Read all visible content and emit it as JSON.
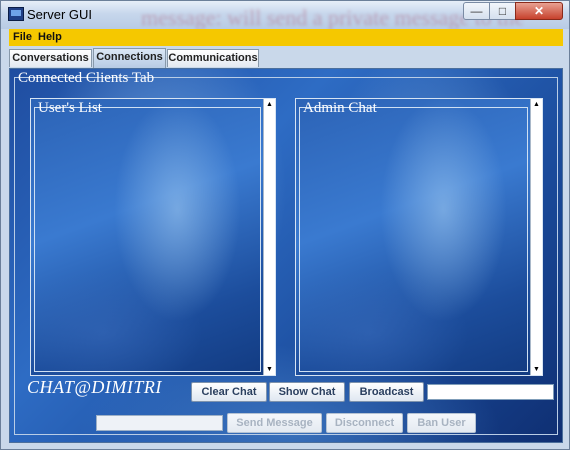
{
  "window": {
    "title": "Server GUI",
    "background_overlay_text": "message: will send a private message to the"
  },
  "menu": {
    "items": [
      {
        "label": "File"
      },
      {
        "label": "Help"
      }
    ]
  },
  "tabs": [
    {
      "label": "Conversations",
      "active": false
    },
    {
      "label": "Connections",
      "active": true
    },
    {
      "label": "Communications",
      "active": false
    }
  ],
  "panel": {
    "title": "Connected Clients Tab",
    "users_list": {
      "title": "User's List"
    },
    "admin_chat": {
      "title": "Admin Chat"
    },
    "brand": "CHAT@DIMITRI"
  },
  "buttons": {
    "clear_chat": "Clear Chat",
    "show_chat": "Show Chat",
    "broadcast": "Broadcast",
    "send_message": "Send Message",
    "disconnect": "Disconnect",
    "ban_user": "Ban User"
  },
  "inputs": {
    "broadcast_value": "",
    "message_value": ""
  },
  "colors": {
    "menubar": "#f5c800",
    "panel_blue": "#2e6cc4",
    "close_button": "#c7412c"
  }
}
